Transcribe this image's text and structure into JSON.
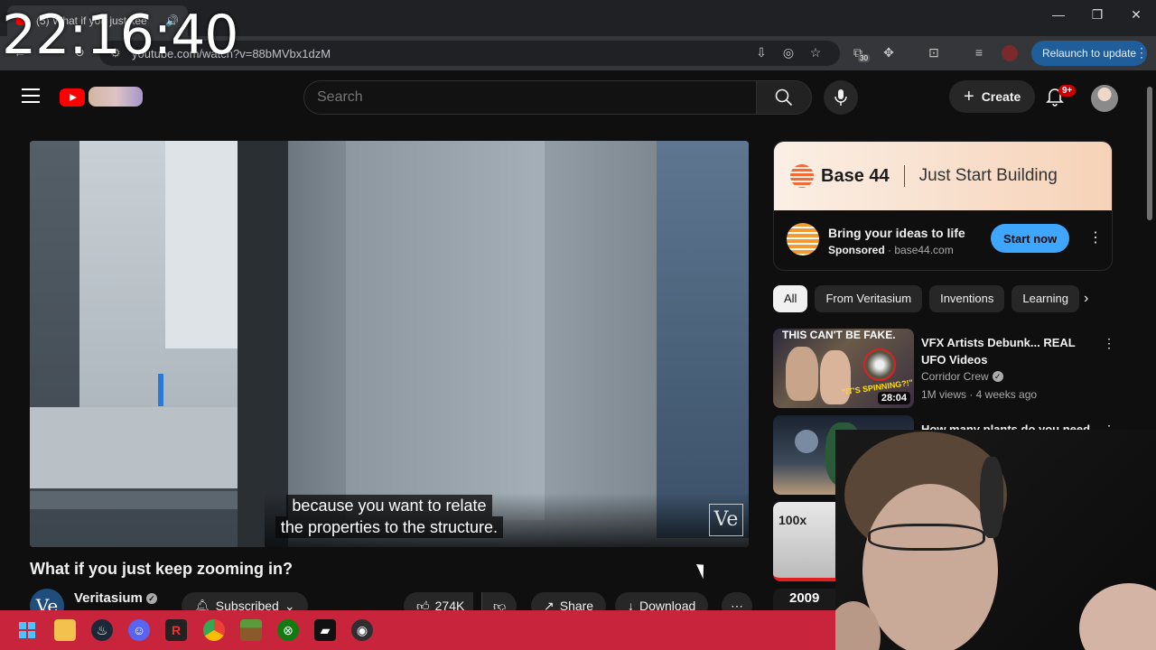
{
  "clock": "22:16:40",
  "browser": {
    "tab_title": "(3) What if you just kee",
    "url": "youtube.com/watch?v=88bMVbx1dzM",
    "extension_badge": "30",
    "relaunch_label": "Relaunch to update",
    "accent": "#1f5e9a"
  },
  "header": {
    "search_placeholder": "Search",
    "create_label": "Create",
    "notifications_badge": "9+"
  },
  "player": {
    "caption_line1": "because you want to relate",
    "caption_line2": "the properties to the structure.",
    "watermark": "Ve"
  },
  "video": {
    "title": "What if you just keep zooming in?",
    "channel_initials": "Ve",
    "channel": "Veritasium",
    "subscribed_label": "Subscribed",
    "likes": "274K",
    "share_label": "Share",
    "download_label": "Download"
  },
  "ad": {
    "brand": "Base 44",
    "tagline": "Just Start Building",
    "title": "Bring your ideas to life",
    "sponsored": "Sponsored",
    "domain": "base44.com",
    "cta": "Start now"
  },
  "chips": [
    "All",
    "From Veritasium",
    "Inventions",
    "Learning"
  ],
  "recommendations": [
    {
      "thumb_text": "THIS CAN'T BE FAKE.",
      "thumb_sub": "\"IT'S SPINNING?!\"",
      "duration": "28:04",
      "title": "VFX Artists Debunk... REAL UFO Videos",
      "channel": "Corridor Crew",
      "meta": "1M views · 4 weeks ago"
    },
    {
      "title": "How many plants do you need"
    },
    {
      "thumb_text": "100x"
    },
    {
      "thumb_text": "2009"
    }
  ],
  "taskbar": {
    "accent": "#c8253d",
    "icons": [
      "windows-icon",
      "file-explorer-icon",
      "steam-icon",
      "discord-icon",
      "r-app-icon",
      "chrome-icon",
      "minecraft-icon",
      "xbox-icon",
      "terminal-icon",
      "obs-icon"
    ]
  }
}
